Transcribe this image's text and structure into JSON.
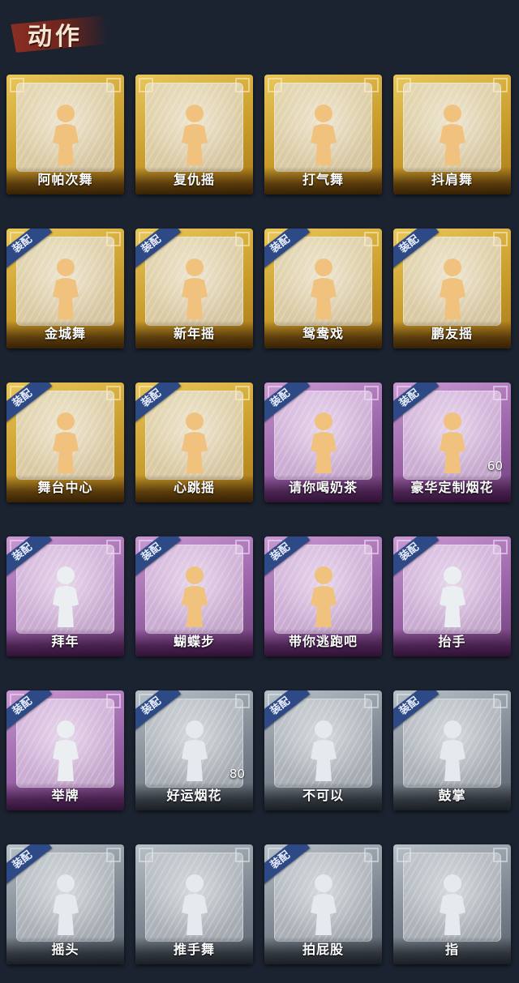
{
  "header": {
    "title": "动作"
  },
  "badge_text": "装配",
  "colors": {
    "gold": "#d4aa3a",
    "purple": "#a56fb3",
    "gray": "#8a939c",
    "badge": "#2e4a86"
  },
  "cards": [
    {
      "label": "阿帕次舞",
      "tier": "gold",
      "equipped": false,
      "icon": "dance-figure-icon",
      "count": ""
    },
    {
      "label": "复仇摇",
      "tier": "gold",
      "equipped": false,
      "icon": "dance-figure-icon",
      "count": ""
    },
    {
      "label": "打气舞",
      "tier": "gold",
      "equipped": false,
      "icon": "dance-figure-icon",
      "count": ""
    },
    {
      "label": "抖肩舞",
      "tier": "gold",
      "equipped": false,
      "icon": "dance-figure-icon",
      "count": ""
    },
    {
      "label": "金城舞",
      "tier": "gold",
      "equipped": true,
      "icon": "dance-figure-icon",
      "count": ""
    },
    {
      "label": "新年摇",
      "tier": "gold",
      "equipped": true,
      "icon": "dance-figure-icon",
      "count": ""
    },
    {
      "label": "鸳鸯戏",
      "tier": "gold",
      "equipped": true,
      "icon": "dance-figure-icon",
      "count": ""
    },
    {
      "label": "鹏友摇",
      "tier": "gold",
      "equipped": true,
      "icon": "dance-figure-icon",
      "count": ""
    },
    {
      "label": "舞台中心",
      "tier": "gold",
      "equipped": true,
      "icon": "dance-figure-icon",
      "count": ""
    },
    {
      "label": "心跳摇",
      "tier": "gold",
      "equipped": true,
      "icon": "dance-figure-icon",
      "count": ""
    },
    {
      "label": "请你喝奶茶",
      "tier": "purple",
      "equipped": true,
      "icon": "milk-tea-figure-icon",
      "count": ""
    },
    {
      "label": "豪华定制烟花",
      "tier": "purple",
      "equipped": true,
      "icon": "fireworks-icon",
      "count": "60"
    },
    {
      "label": "拜年",
      "tier": "purple",
      "equipped": true,
      "icon": "bow-figure-icon",
      "count": ""
    },
    {
      "label": "蝴蝶步",
      "tier": "purple",
      "equipped": true,
      "icon": "dance-figure-icon",
      "count": ""
    },
    {
      "label": "带你逃跑吧",
      "tier": "purple",
      "equipped": true,
      "icon": "dance-figure-icon",
      "count": ""
    },
    {
      "label": "抬手",
      "tier": "purple",
      "equipped": true,
      "icon": "raise-hand-figure-icon",
      "count": ""
    },
    {
      "label": "举牌",
      "tier": "purple",
      "equipped": true,
      "icon": "sign-figure-icon",
      "count": ""
    },
    {
      "label": "好运烟花",
      "tier": "gray",
      "equipped": true,
      "icon": "firework-can-icon",
      "count": "80"
    },
    {
      "label": "不可以",
      "tier": "gray",
      "equipped": true,
      "icon": "finger-wag-icon",
      "count": ""
    },
    {
      "label": "鼓掌",
      "tier": "gray",
      "equipped": true,
      "icon": "clap-hands-icon",
      "count": ""
    },
    {
      "label": "摇头",
      "tier": "gray",
      "equipped": true,
      "icon": "shake-head-figure-icon",
      "count": ""
    },
    {
      "label": "推手舞",
      "tier": "gray",
      "equipped": false,
      "icon": "push-hands-figure-icon",
      "count": ""
    },
    {
      "label": "拍屁股",
      "tier": "gray",
      "equipped": true,
      "icon": "spank-figure-icon",
      "count": ""
    },
    {
      "label": "指",
      "tier": "gray",
      "equipped": false,
      "icon": "point-hand-icon",
      "count": ""
    }
  ]
}
